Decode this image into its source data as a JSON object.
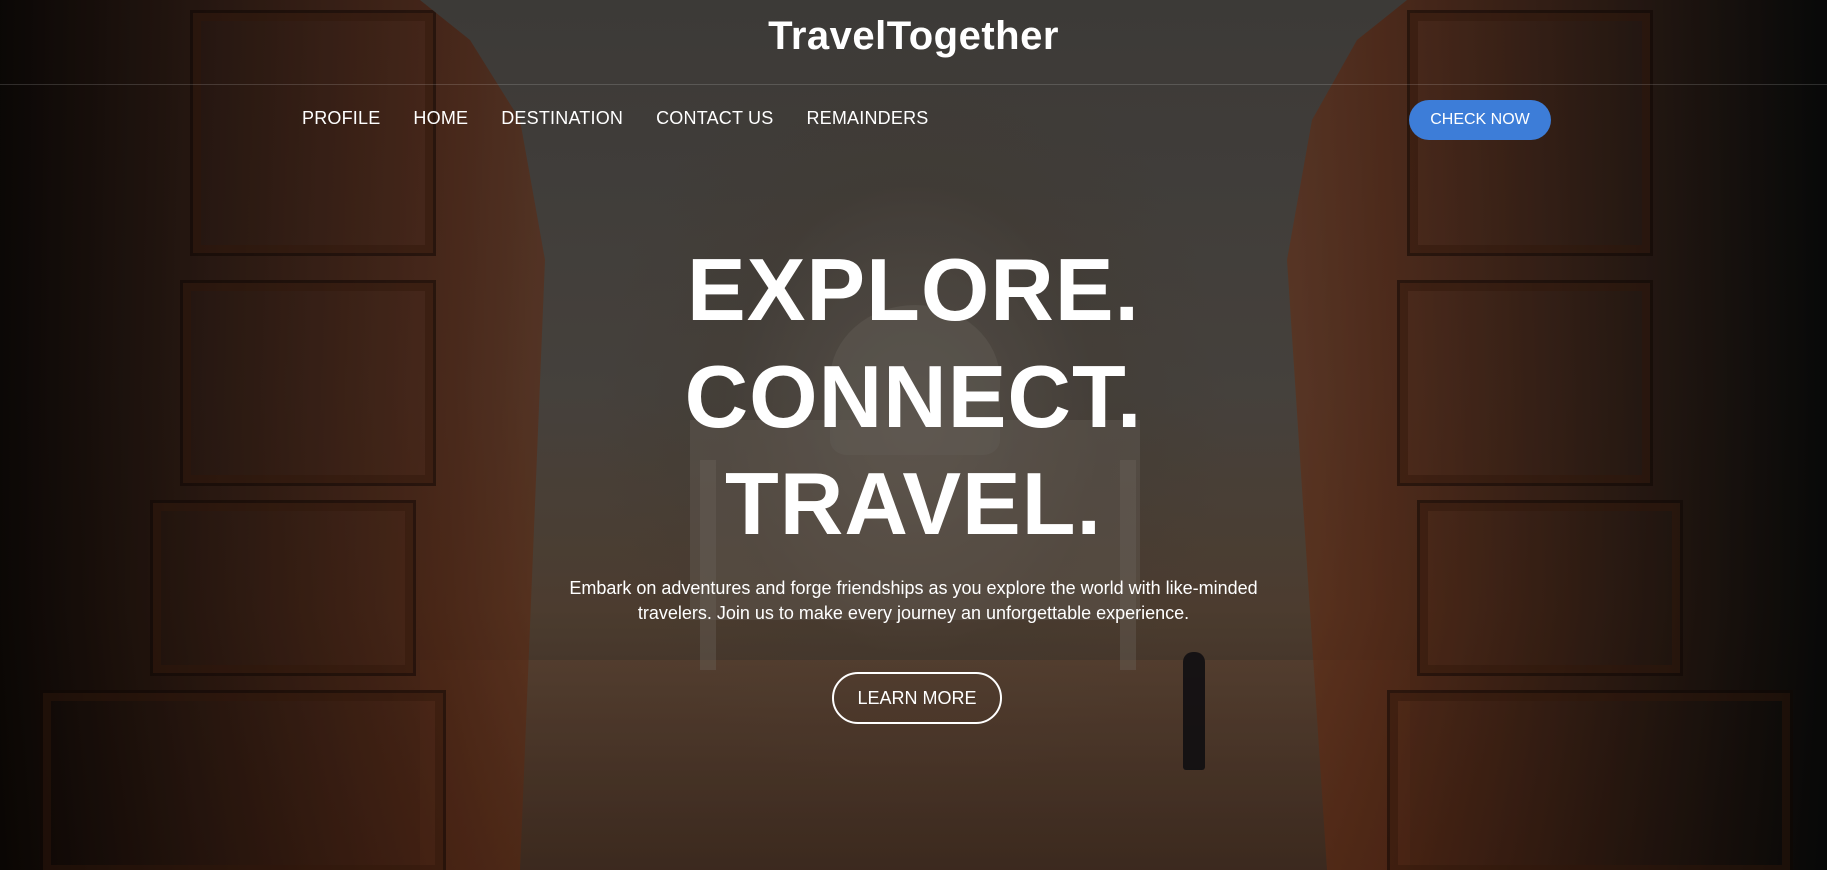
{
  "header": {
    "brand": "TravelTogether"
  },
  "nav": {
    "items": [
      "PROFILE",
      "HOME",
      "DESTINATION",
      "CONTACT US",
      "REMAINDERS"
    ],
    "cta_label": "CHECK NOW"
  },
  "hero": {
    "line1": "EXPLORE.",
    "line2": "CONNECT.",
    "line3": "TRAVEL.",
    "tagline_line1": "Embark on adventures and forge friendships as you explore the world with like-minded",
    "tagline_line2": "travelers. Join us to make every journey an unforgettable experience.",
    "button_label": "LEARN MORE"
  },
  "colors": {
    "accent": "#3d7dd8",
    "text": "#ffffff"
  }
}
